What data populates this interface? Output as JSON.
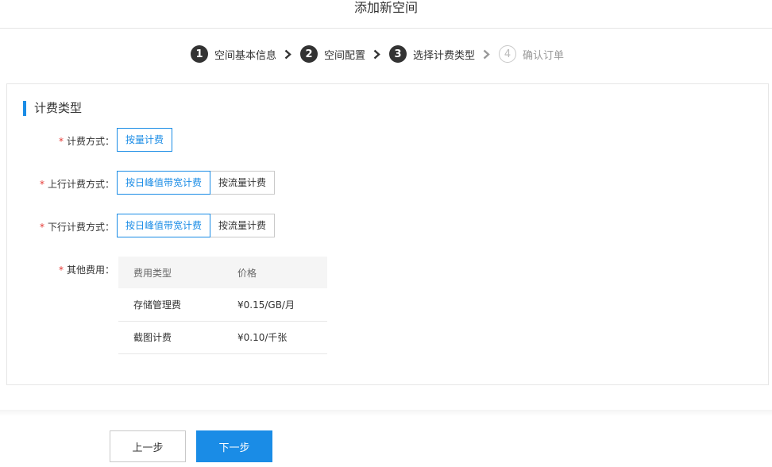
{
  "header": {
    "title": "添加新空间"
  },
  "steps": [
    {
      "number": "1",
      "label": "空间基本信息",
      "state": "done"
    },
    {
      "number": "2",
      "label": "空间配置",
      "state": "done"
    },
    {
      "number": "3",
      "label": "选择计费类型",
      "state": "current"
    },
    {
      "number": "4",
      "label": "确认订单",
      "state": "pending"
    }
  ],
  "section": {
    "title": "计费类型"
  },
  "form": {
    "required_mark": "*",
    "billing_method": {
      "label": "计费方式：",
      "options": [
        "按量计费"
      ],
      "selected": "按量计费"
    },
    "upstream_billing": {
      "label": "上行计费方式：",
      "options": [
        "按日峰值带宽计费",
        "按流量计费"
      ],
      "selected": "按日峰值带宽计费"
    },
    "downstream_billing": {
      "label": "下行计费方式：",
      "options": [
        "按日峰值带宽计费",
        "按流量计费"
      ],
      "selected": "按日峰值带宽计费"
    },
    "other_fees": {
      "label": "其他费用：",
      "columns": [
        "费用类型",
        "价格"
      ],
      "rows": [
        [
          "存储管理费",
          "¥0.15/GB/月"
        ],
        [
          "截图计费",
          "¥0.10/千张"
        ]
      ]
    }
  },
  "footer": {
    "prev_label": "上一步",
    "next_label": "下一步"
  },
  "colors": {
    "accent": "#1a8ce6",
    "step_active": "#333333",
    "required": "#e53935"
  }
}
